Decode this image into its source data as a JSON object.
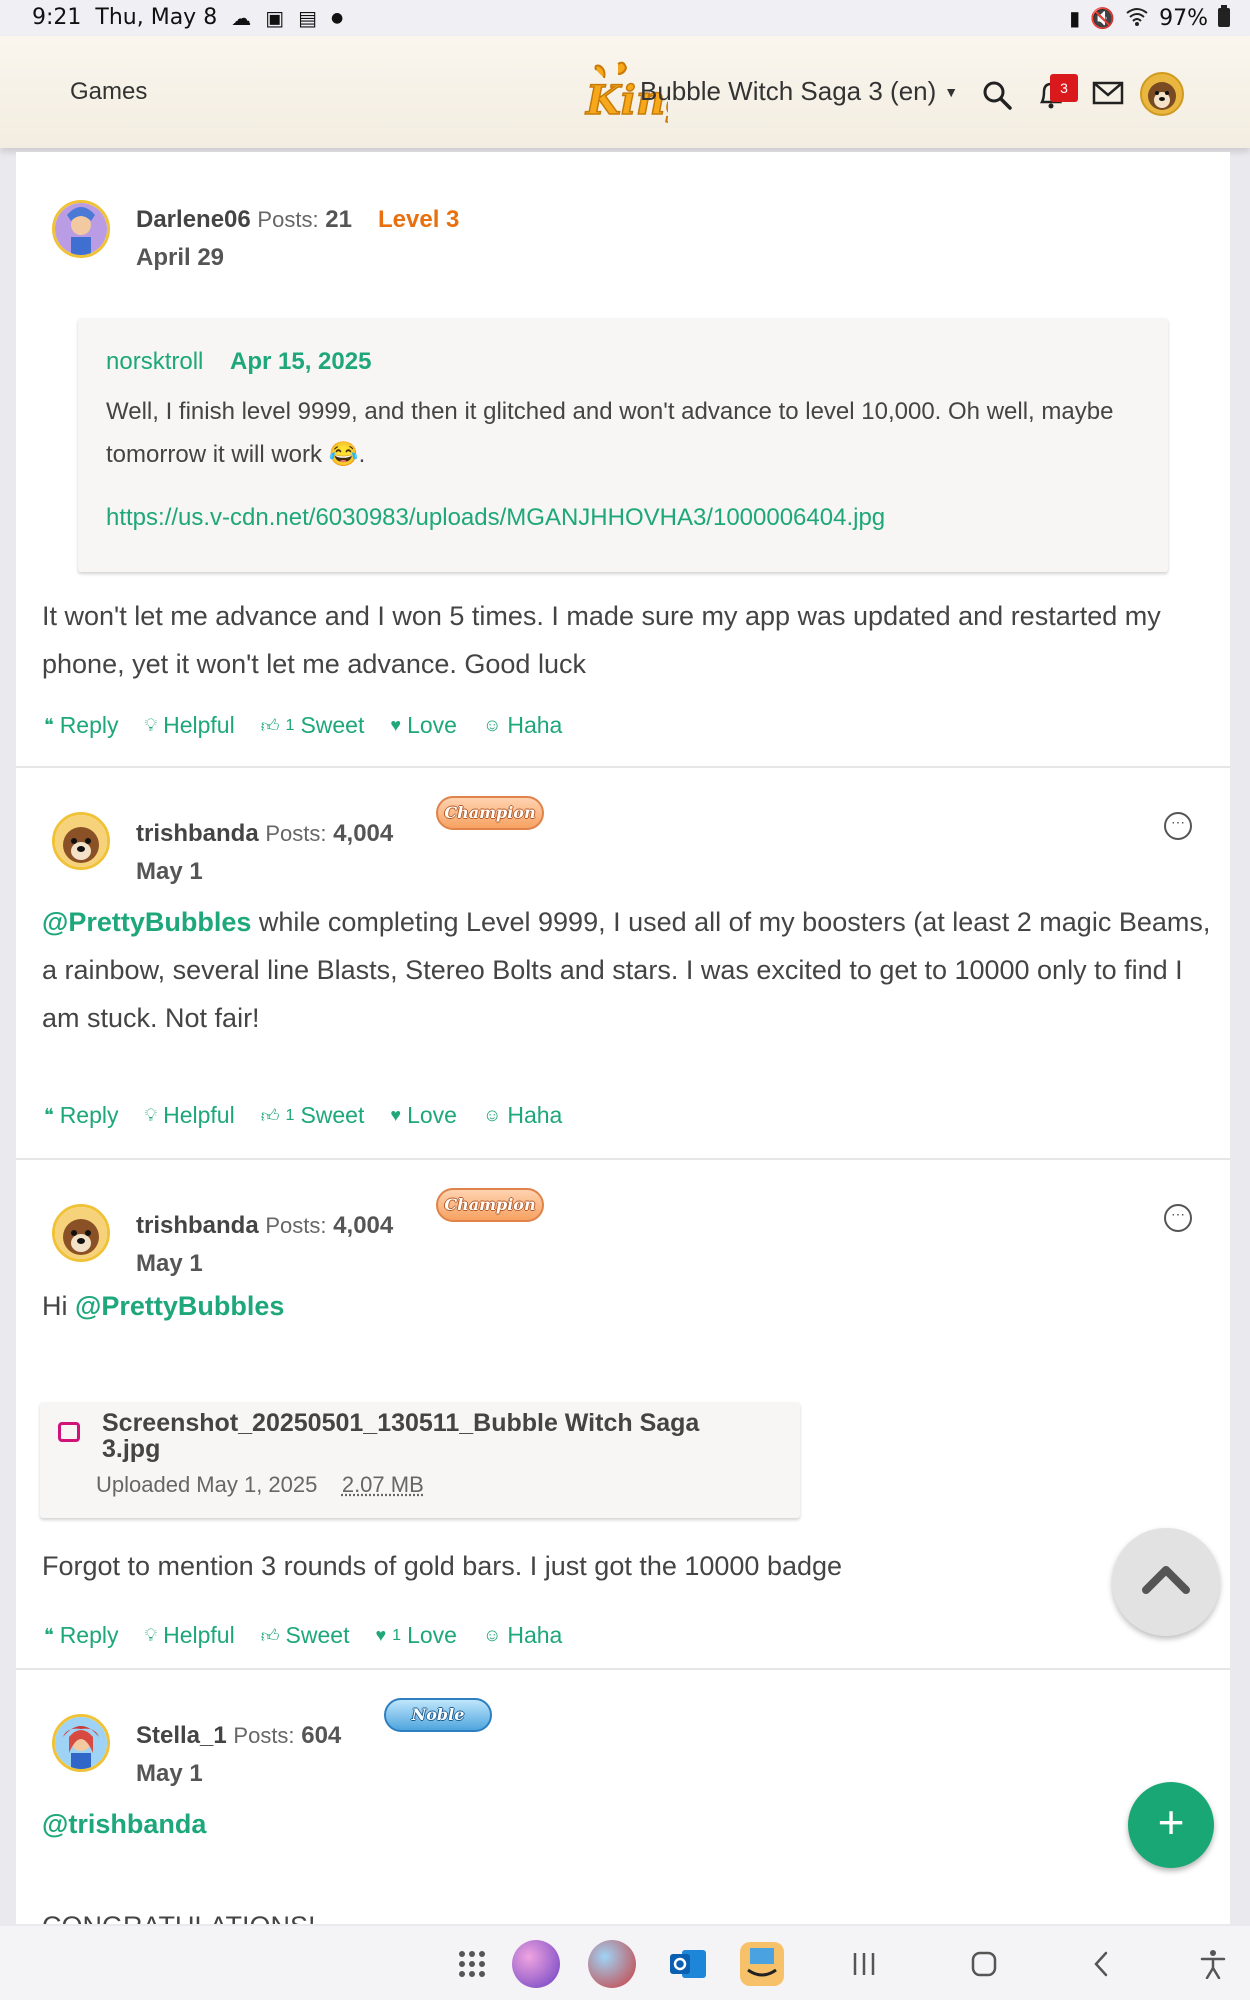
{
  "status_bar": {
    "time": "9:21",
    "date": "Thu, May 8",
    "battery": "97%",
    "left_icons": [
      "cloud-icon",
      "image-icon",
      "calendar-icon",
      "dot-icon"
    ],
    "right_icons": [
      "sim-icon",
      "mute-icon",
      "wifi-icon",
      "battery-icon"
    ]
  },
  "header": {
    "games_label": "Games",
    "logo_text": "King",
    "forum_title": "Bubble Witch Saga 3 (en)",
    "notification_count": "3",
    "colors": {
      "accent": "#1da77a",
      "notif": "#d9191c",
      "level": "#e8700e"
    }
  },
  "posts": [
    {
      "username": "Darlene06",
      "posts_label": "Posts:",
      "posts_count": "21",
      "level": "Level 3",
      "date": "April 29",
      "quote": {
        "author": "norsktroll",
        "date": "Apr 15, 2025",
        "body": "Well, I finish level 9999, and then it glitched and won't advance to level 10,000. Oh well, maybe tomorrow it will work",
        "emoji": "😂",
        "trailing": ".",
        "link": "https://us.v-cdn.net/6030983/uploads/MGANJHHOVHA3/1000006404.jpg"
      },
      "body": "It won't let me advance and I won 5 times. I made sure my app was updated and restarted my phone, yet it won't let me advance. Good luck",
      "reactions": {
        "reply": "Reply",
        "helpful": "Helpful",
        "sweet_count": "1",
        "sweet": "Sweet",
        "love": "Love",
        "haha": "Haha"
      }
    },
    {
      "username": "trishbanda",
      "posts_label": "Posts:",
      "posts_count": "4,004",
      "badge": "Champion",
      "date": "May 1",
      "mention": "@PrettyBubbles",
      "body": " while completing Level 9999, I used all of my boosters (at least 2 magic Beams, a rainbow, several line Blasts, Stereo Bolts and stars. I was excited to get to 10000 only to find I am stuck. Not fair!",
      "reactions": {
        "reply": "Reply",
        "helpful": "Helpful",
        "sweet_count": "1",
        "sweet": "Sweet",
        "love": "Love",
        "haha": "Haha"
      }
    },
    {
      "username": "trishbanda",
      "posts_label": "Posts:",
      "posts_count": "4,004",
      "badge": "Champion",
      "date": "May 1",
      "greeting": "Hi ",
      "mention": "@PrettyBubbles",
      "attachment": {
        "name": "Screenshot_20250501_130511_Bubble Witch Saga 3.jpg",
        "uploaded": "Uploaded May 1, 2025",
        "size": "2.07 MB"
      },
      "body": "Forgot to mention 3 rounds of gold bars. I just got the 10000 badge",
      "reactions": {
        "reply": "Reply",
        "helpful": "Helpful",
        "sweet": "Sweet",
        "love_count": "1",
        "love": "Love",
        "haha": "Haha"
      }
    },
    {
      "username": "Stella_1",
      "posts_label": "Posts:",
      "posts_count": "604",
      "badge": "Noble",
      "date": "May 1",
      "mention": "@trishbanda",
      "partial_text": "CONGRATULATIONS!"
    }
  ],
  "fab_label": "+",
  "nav": {
    "apps": [
      "apps-grid-icon",
      "bubble-witch-app-icon",
      "bubble-witch-2-app-icon",
      "outlook-app-icon",
      "amazon-app-icon"
    ],
    "buttons": [
      "recents-button",
      "home-button",
      "back-button",
      "accessibility-button"
    ]
  }
}
